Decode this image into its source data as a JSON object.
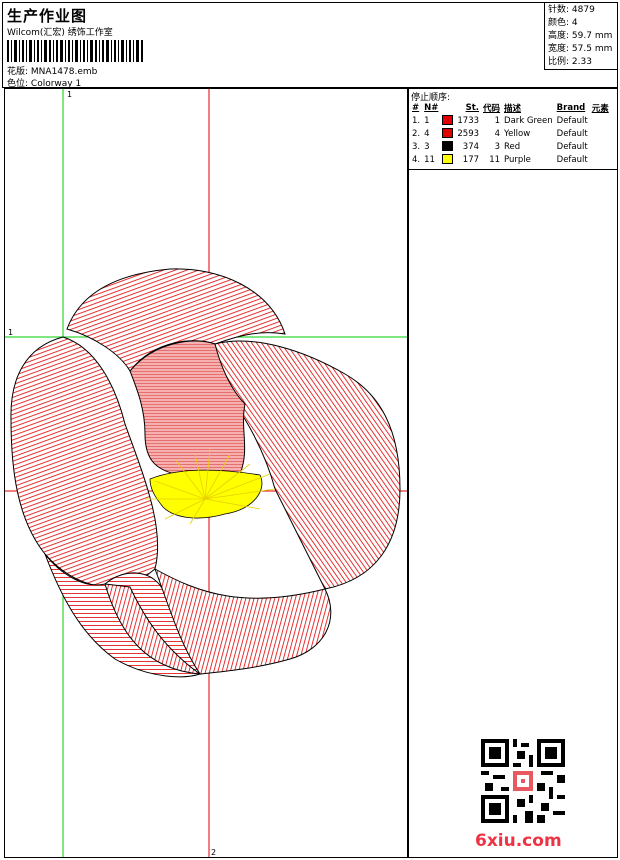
{
  "header": {
    "title": "生产作业图",
    "subtitle": "Wilcom(汇宏) 绣饰工作室",
    "design_label": "花版:",
    "design_value": "MNA1478.emb",
    "color_label": "色位:",
    "color_value": "Colorway 1"
  },
  "stats": {
    "stitches_label": "针数:",
    "stitches_value": "4879",
    "colors_label": "颜色:",
    "colors_value": "4",
    "height_label": "高度:",
    "height_value": "59.7 mm",
    "width_label": "宽度:",
    "width_value": "57.5 mm",
    "scale_label": "比例:",
    "scale_value": "2.33"
  },
  "canvas": {
    "axis_top": "1",
    "axis_left": "1",
    "axis_bottom": "2"
  },
  "stop_sequence": {
    "title": "停止顺序:",
    "columns": [
      "#",
      "N#",
      "St.",
      "代码",
      "描述",
      "Brand",
      "元素"
    ],
    "rows": [
      {
        "idx": "1.",
        "n": "1",
        "color": "#e00000",
        "st": "1733",
        "code": "1",
        "desc": "Dark Green",
        "brand": "Default"
      },
      {
        "idx": "2.",
        "n": "4",
        "color": "#e00000",
        "st": "2593",
        "code": "4",
        "desc": "Yellow",
        "brand": "Default"
      },
      {
        "idx": "3.",
        "n": "3",
        "color": "#000000",
        "st": "374",
        "code": "3",
        "desc": "Red",
        "brand": "Default"
      },
      {
        "idx": "4.",
        "n": "11",
        "color": "#ffff00",
        "st": "177",
        "code": "11",
        "desc": "Purple",
        "brand": "Default"
      }
    ]
  },
  "watermark": {
    "site": "6xiu.com"
  },
  "colors": {
    "stitch_red": "#e00000",
    "stitch_yellow": "#ffff00",
    "guide_green": "#00cc00",
    "guide_red": "#e00000"
  }
}
